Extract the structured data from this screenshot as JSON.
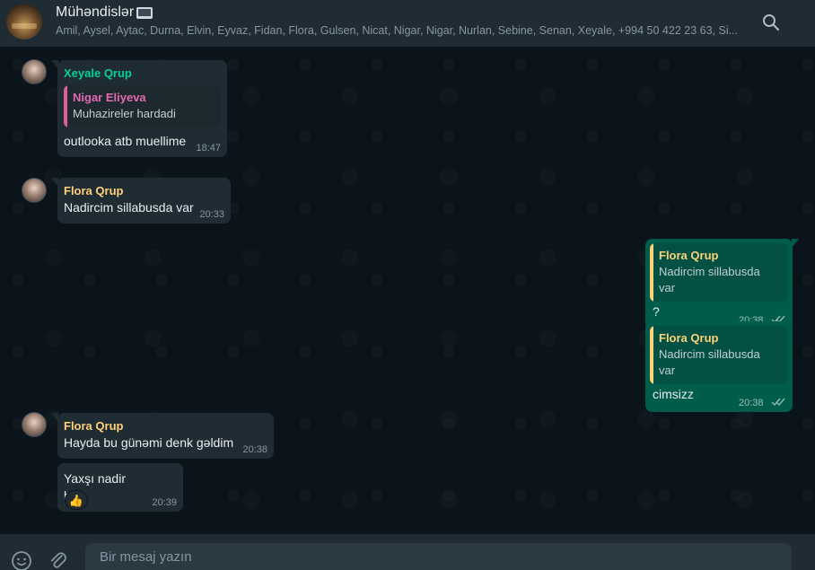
{
  "header": {
    "title": "Mühəndislər",
    "title_emoji": "laptop-emoji",
    "members": "Amil, Aysel, Aytac, Durna, Elvin, Eyvaz, Fidan, Flora, Gulsen, Nicat, Nigar, Nigar, Nurlan, Sebine, Senan, Xeyale, +994 50 422 23 63, Si..."
  },
  "messages": {
    "m1": {
      "sender": "Xeyale Qrup",
      "quote_name": "Nigar Eliyeva",
      "quote_text": "Muhazireler hardadi",
      "text": "outlooka atb muellime",
      "time": "18:47"
    },
    "m2": {
      "sender": "Flora Qrup",
      "text": "Nadircim sillabusda var",
      "time": "20:33"
    },
    "m3": {
      "quote_name": "Flora Qrup",
      "quote_text": "Nadircim sillabusda var",
      "text": "?",
      "time": "20:38"
    },
    "m4": {
      "quote_name": "Flora Qrup",
      "quote_text": "Nadircim sillabusda var",
      "text": "cimsizz",
      "time": "20:38"
    },
    "m5": {
      "sender": "Flora Qrup",
      "text": "Hayda bu günəmi denk gəldim",
      "time": "20:38"
    },
    "m6": {
      "text": "Yaxşı nadir bəy",
      "time": "20:39",
      "reaction": "👍"
    }
  },
  "composer": {
    "placeholder": "Bir mesaj yazın"
  },
  "icons": {
    "search": "search-icon",
    "emoji": "emoji-icon",
    "attach": "paperclip-icon",
    "read_receipt": "double-check-icon"
  },
  "colors": {
    "background": "#0b141a",
    "header": "#202c33",
    "incoming": "#202c33",
    "outgoing": "#005c4b",
    "sender_green": "#06cf9c",
    "sender_yellow": "#ffd279",
    "quote_pink": "#e26ab2"
  }
}
